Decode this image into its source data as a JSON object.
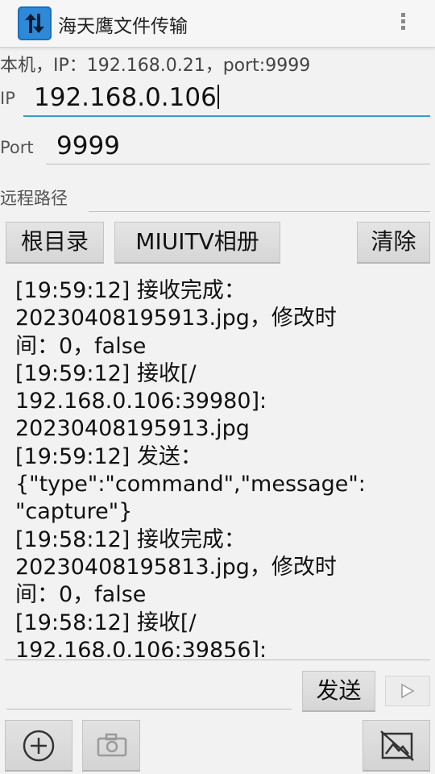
{
  "app": {
    "title": "海天鹰文件传输",
    "icon": "up-down-arrows-icon",
    "accent_color": "#2f9fd0",
    "icon_color": "#2e8ad8"
  },
  "local_info": "本机，IP：192.168.0.21，port:9999",
  "form": {
    "ip_label": "IP",
    "ip_value": "192.168.0.106",
    "port_label": "Port",
    "port_value": "9999",
    "remote_path_label": "远程路径",
    "remote_path_value": ""
  },
  "buttons": {
    "root_dir": "根目录",
    "miuitv_album": "MIUITV相册",
    "clear": "清除",
    "send": "发送"
  },
  "log_lines": [
    "[19:59:12] 接收完成：",
    "20230408195913.jpg，修改时",
    "间：0，false",
    "[19:59:12] 接收[/",
    "192.168.0.106:39980]:",
    "20230408195913.jpg",
    "[19:59:12] 发送：",
    "{\"type\":\"command\",\"message\":",
    "\"capture\"}",
    "[19:58:12] 接收完成：",
    "20230408195813.jpg，修改时",
    "间：0，false",
    "[19:58:12] 接收[/",
    "192.168.0.106:39856]:"
  ],
  "message_input": {
    "value": ""
  },
  "bottom_bar": {
    "add_icon": "plus-circle-icon",
    "camera_icon": "camera-icon",
    "image_icon": "image-icon"
  }
}
